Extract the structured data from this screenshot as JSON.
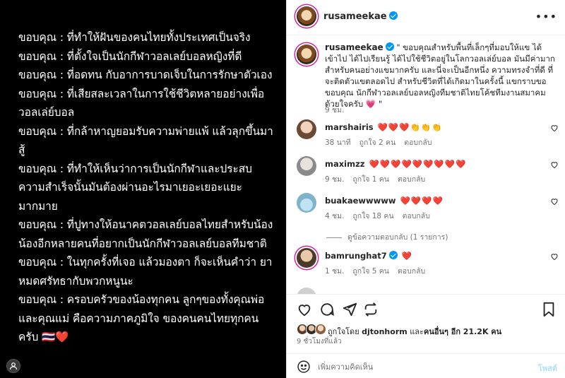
{
  "media": {
    "lines": [
      "ขอบคุณ : ที่ทำให้ฝันของคนไทยทั้งประเทศเป็นจริง",
      "ขอบคุณ : ที่ตั้งใจเป็นนักกีฬาวอลเลย์บอลหญิงที่ดี",
      "ขอบคุณ : ที่อดทน กับอาการบาดเจ็บในการรักษาตัวเอง",
      "ขอบคุณ : ที่เสียสละเวลาในการใช้ชีวิตหลายอย่างเพื่อ",
      "วอลเล่ย์บอล",
      "ขอบคุณ : ที่กล้าหาญยอมรับความพ่ายแพ้ แล้วลุกขึ้นมา",
      "สู้",
      "ขอบคุณ : ที่ทำให้เห็นว่าการเป็นนักกีฬาและประสบ",
      "ความสำเร็จนั้นมันต้องผ่านอะไรมาเยอะเยอะแยะ",
      "มากมาย",
      "ขอบคุณ : ที่ปูทางให้อนาคตวอลเลย์บอลไทยสำหรับน้อง",
      "น้องอีกหลายคนที่อยากเป็นนักกีฬาวอลเลย์บอลทีมชาติ",
      "ขอบคุณ : ในทุกครั้งที่เจอ แล้วมองตา ก็จะเห็นคำว่า ยา",
      "หมดศรัทธากับพวกหนูนะ",
      "ขอบคุณ : ครอบครัวของน้องทุกคน ลูกๆของทั้งคุณพ่อ",
      "และคุณแม่ คือความภาคภูมิใจ ของคนคนไทยทุกคน",
      "ครับ 🇹🇭❤️"
    ]
  },
  "header": {
    "username": "rusameekae",
    "more_icon": "more-horizontal-icon"
  },
  "caption": {
    "username": "rusameekae",
    "text": "\" ขอบคุณสำหรับพื้นที่เล็กๆที่มอบให้แข ได้เข้าไป ได้ไปเรียนรู้ ได้ไปใช้ชีวิตอยู่ในโลกวอลเล่ย์บอล มันมีค่ามาก สำหรับคนอย่างแขมากครับ และนี่จะเป็นอีกหนึ่ง ความทรงจำที่ดี ที่จะติดตัวแขตลอดไป สำหรับชีวิตที่ได้เกิดมาในครั้งนี้ แขกราบขอขอบคุณ นักกีฬาวอลเลย์บอลหญิงทีมชาติไทยโค้ชทีมงานสมาคม ด้วยใจครับ 💗 \"",
    "time": "9 ชม."
  },
  "comments": [
    {
      "username": "marshairis",
      "verified": false,
      "text": "❤️❤️❤️👏👏👏",
      "time": "38 นาที",
      "likes": "ถูกใจ 2 คน",
      "reply": "ตอบกลับ"
    },
    {
      "username": "maximzz",
      "verified": false,
      "text": "❤️❤️❤️❤️❤️❤️❤️❤️❤️",
      "time": "9 ชม.",
      "likes": "ถูกใจ 1 คน",
      "reply": "ตอบกลับ"
    },
    {
      "username": "buakaewwwww",
      "verified": false,
      "text": "❤️❤️❤️❤️",
      "time": "4 ชม.",
      "likes": "ถูกใจ 18 คน",
      "reply": "ตอบกลับ"
    },
    {
      "username": "bamrunghat7",
      "verified": true,
      "text": "❤️",
      "time": "1 ชม.",
      "likes": "ถูกใจ 5 คน",
      "reply": "ตอบกลับ"
    }
  ],
  "view_replies": "ดูข้อความตอบกลับ (1 รายการ)",
  "actions": {
    "like_icon": "heart-icon",
    "comment_icon": "comment-icon",
    "share_icon": "share-icon",
    "save_icon": "bookmark-icon"
  },
  "likes": {
    "prefix": "ถูกใจโดย",
    "user": "djtonhorm",
    "middle": "และ",
    "others": "คนอื่นๆ อีก 21.2K คน"
  },
  "post_time": "9 ชั่วโมงที่แล้ว",
  "add_comment": {
    "placeholder": "เพิ่มความคิดเห็น",
    "post_label": "โพสต์"
  },
  "colors": {
    "accent": "#0095f6",
    "heart": "#ed1b47",
    "muted": "#737373"
  }
}
